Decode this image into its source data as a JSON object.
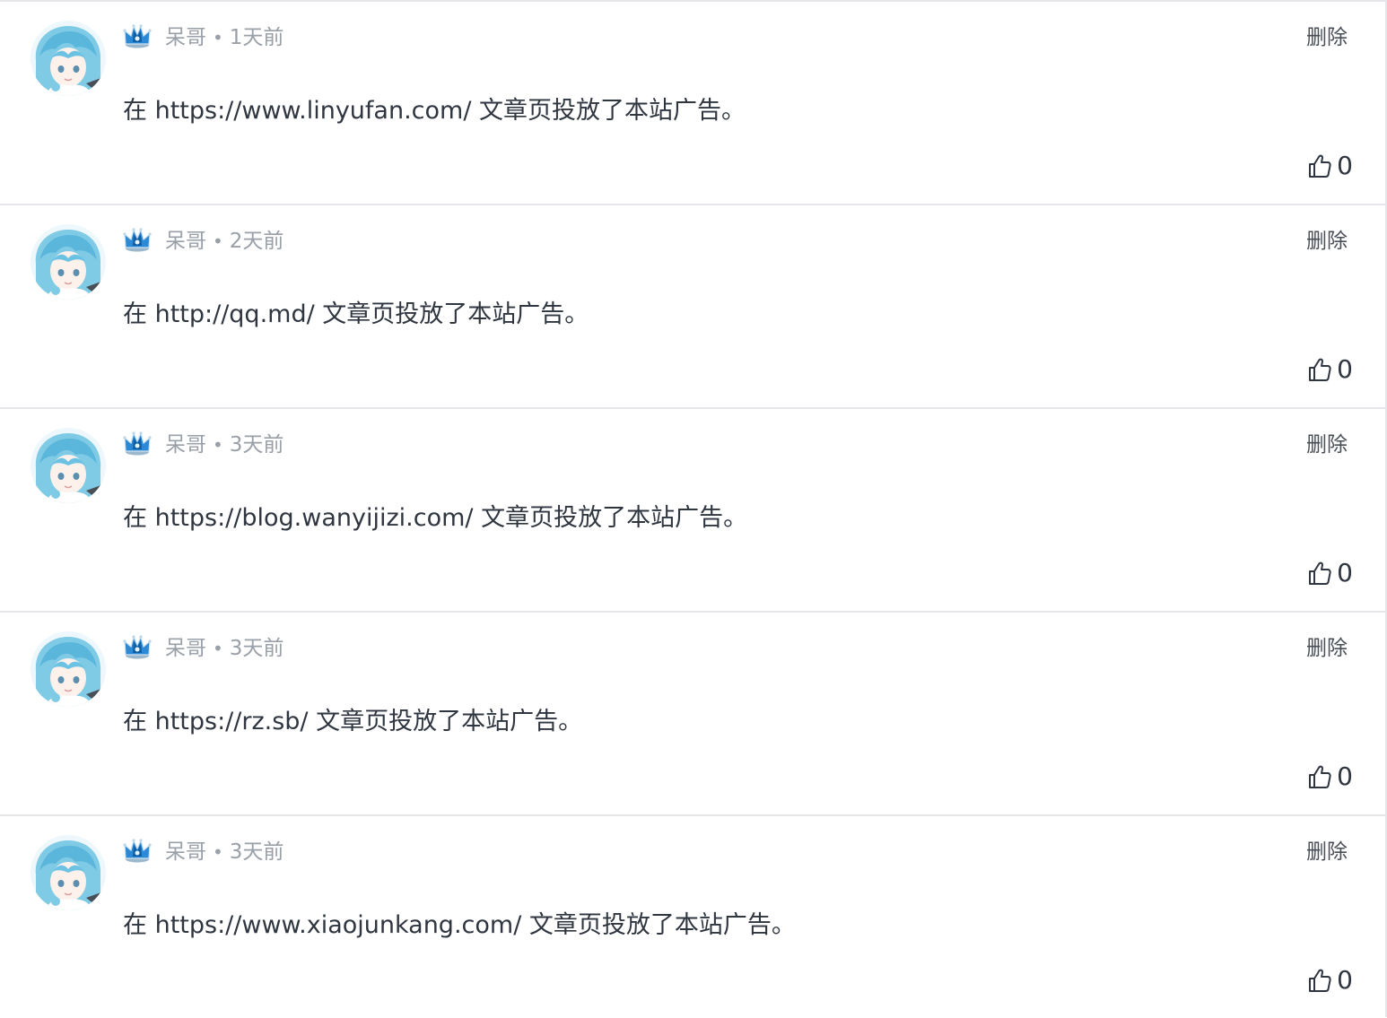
{
  "comments": [
    {
      "username": "呆哥",
      "separator": "•",
      "time": "1天前",
      "delete_label": "删除",
      "content": "在 https://www.linyufan.com/ 文章页投放了本站广告。",
      "likes": "0"
    },
    {
      "username": "呆哥",
      "separator": "•",
      "time": "2天前",
      "delete_label": "删除",
      "content": "在 http://qq.md/ 文章页投放了本站广告。",
      "likes": "0"
    },
    {
      "username": "呆哥",
      "separator": "•",
      "time": "3天前",
      "delete_label": "删除",
      "content": "在 https://blog.wanyijizi.com/ 文章页投放了本站广告。",
      "likes": "0"
    },
    {
      "username": "呆哥",
      "separator": "•",
      "time": "3天前",
      "delete_label": "删除",
      "content": "在 https://rz.sb/ 文章页投放了本站广告。",
      "likes": "0"
    },
    {
      "username": "呆哥",
      "separator": "•",
      "time": "3天前",
      "delete_label": "删除",
      "content": "在 https://www.xiaojunkang.com/ 文章页投放了本站广告。",
      "likes": "0"
    }
  ],
  "icons": {
    "badge": "crown-icon",
    "like": "thumbs-up-icon"
  },
  "colors": {
    "meta_text": "#9aa0a8",
    "body_text": "#2f3640",
    "divider": "#e4e6ea",
    "crown_blue": "#1e88d8"
  }
}
